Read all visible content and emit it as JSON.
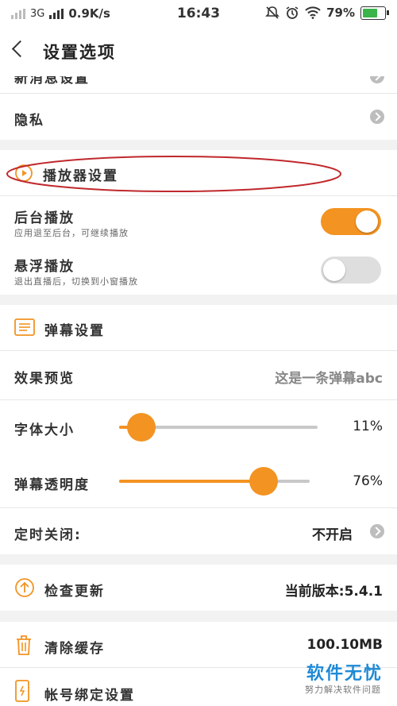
{
  "status_bar": {
    "network": "3G",
    "speed": "0.9K/s",
    "time": "16:43",
    "battery": "79%",
    "battery_level": 0.79
  },
  "header": {
    "title": "设置选项"
  },
  "rows": {
    "partial_label": "新消息设置",
    "privacy": "隐私",
    "player_section": "播放器设置",
    "bg_play": {
      "label": "后台播放",
      "desc": "应用退至后台，可继续播放",
      "on": true
    },
    "float_play": {
      "label": "悬浮播放",
      "desc": "退出直播后，切换到小窗播放",
      "on": false
    },
    "danmaku_section": "弹幕设置",
    "preview": {
      "label": "效果预览",
      "value": "这是一条弹幕abc"
    },
    "font_size": {
      "label": "字体大小",
      "value": "11%",
      "level": 0.11
    },
    "opacity": {
      "label": "弹幕透明度",
      "value": "76%",
      "level": 0.76
    },
    "timer": {
      "label": "定时关闭:",
      "value": "不开启"
    },
    "update": {
      "label": "检查更新",
      "value": "当前版本:5.4.1"
    },
    "cache": {
      "label": "清除缓存",
      "value": "100.10MB"
    },
    "account": {
      "label": "帐号绑定设置"
    }
  },
  "watermark": {
    "title": "软件无忧",
    "subtitle": "努力解决软件问题"
  },
  "colors": {
    "accent": "#f39322",
    "annotation": "#c0282c",
    "toggle_off": "#dedede"
  }
}
